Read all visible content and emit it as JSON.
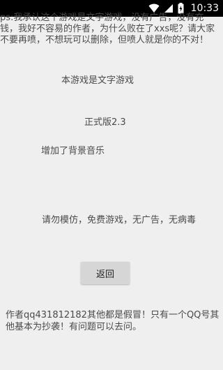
{
  "status_bar": {
    "time": "10:33",
    "icons": [
      "wifi-icon",
      "signal-icon",
      "battery-charging-icon"
    ]
  },
  "notice": {
    "text": "ps:我承认这个游戏是文字游戏，没有广告，没有充钱，我好不容易的作者，为什么败在了xxs呢？请大家不要再喷，不想玩可以删除，但喷人就是你的不对！"
  },
  "info": {
    "game_type": "本游戏是文字游戏",
    "version": "正式版2.3",
    "bgm": "增加了背景音乐",
    "disclaimer": "请勿模仿，免费游戏，无广告，无病毒"
  },
  "back_button": {
    "label": "返回"
  },
  "author": {
    "text": "作者qq431812182其他都是假冒！只有一个QQ号其他基本为抄袭！有问题可以去问。"
  },
  "colors": {
    "background": "#efefef",
    "status_bar": "#000000",
    "button": "#d6d6d6"
  }
}
